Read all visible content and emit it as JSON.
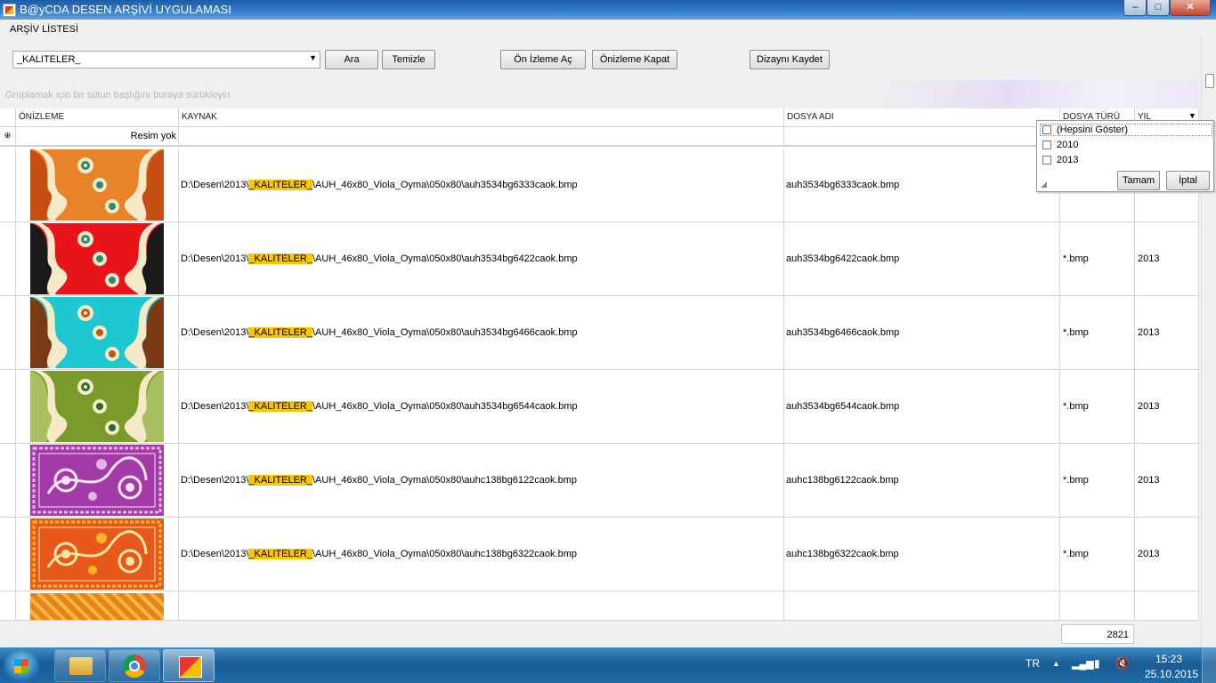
{
  "window": {
    "title": "B@yCDA DESEN ARŞİVİ UYGULAMASI",
    "controls": {
      "minimize": "–",
      "maximize": "□",
      "close": "✕"
    }
  },
  "menu": {
    "arsiv_listesi": "ARŞİV LİSTESİ"
  },
  "toolbar": {
    "combo_value": "_KALITELER_",
    "ara": "Ara",
    "temizle": "Temizle",
    "onizleme_ac": "Ön İzleme Aç",
    "onizleme_kapat": "Önizleme Kapat",
    "dizayn_kaydet": "Dizaynı Kaydet"
  },
  "grid": {
    "group_hint": "Gruplamak için bir sütun başlığını buraya sürükleyin",
    "columns": [
      "ÖNİZLEME",
      "KAYNAK",
      "DOSYA ADI",
      "DOSYA TÜRÜ",
      "YIL"
    ],
    "filter_row": {
      "preview": "Resim yok"
    },
    "rows": [
      {
        "path_pre": "D:\\Desen\\2013\\",
        "path_hl": "_KALITELER_",
        "path_post": "\\AUH_46x80_Viola_Oyma\\050x80\\auh3534bg6333caok.bmp",
        "file": "auh3534bg6333caok.bmp",
        "type": "",
        "year": "",
        "palette": "orange-swirl"
      },
      {
        "path_pre": "D:\\Desen\\2013\\",
        "path_hl": "_KALITELER_",
        "path_post": "\\AUH_46x80_Viola_Oyma\\050x80\\auh3534bg6422caok.bmp",
        "file": "auh3534bg6422caok.bmp",
        "type": "*.bmp",
        "year": "2013",
        "palette": "red-swirl"
      },
      {
        "path_pre": "D:\\Desen\\2013\\",
        "path_hl": "_KALITELER_",
        "path_post": "\\AUH_46x80_Viola_Oyma\\050x80\\auh3534bg6466caok.bmp",
        "file": "auh3534bg6466caok.bmp",
        "type": "*.bmp",
        "year": "2013",
        "palette": "cyan-swirl"
      },
      {
        "path_pre": "D:\\Desen\\2013\\",
        "path_hl": "_KALITELER_",
        "path_post": "\\AUH_46x80_Viola_Oyma\\050x80\\auh3534bg6544caok.bmp",
        "file": "auh3534bg6544caok.bmp",
        "type": "*.bmp",
        "year": "2013",
        "palette": "olive-swirl"
      },
      {
        "path_pre": "D:\\Desen\\2013\\",
        "path_hl": "_KALITELER_",
        "path_post": "\\AUH_46x80_Viola_Oyma\\050x80\\auhc138bg6122caok.bmp",
        "file": "auhc138bg6122caok.bmp",
        "type": "*.bmp",
        "year": "2013",
        "palette": "purple-ornament"
      },
      {
        "path_pre": "D:\\Desen\\2013\\",
        "path_hl": "_KALITELER_",
        "path_post": "\\AUH_46x80_Viola_Oyma\\050x80\\auhc138bg6322caok.bmp",
        "file": "auhc138bg6322caok.bmp",
        "type": "*.bmp",
        "year": "2013",
        "palette": "orange-ornament"
      }
    ],
    "record_count": "2821"
  },
  "filter_popup": {
    "items": [
      "(Hepsini Göster)",
      "2010",
      "2013"
    ],
    "ok": "Tamam",
    "cancel": "İptal"
  },
  "taskbar": {
    "apps": [
      "explorer-icon",
      "chrome-icon",
      "app-icon"
    ],
    "language": "TR",
    "time": "15:23",
    "date": "25.10.2015"
  },
  "colors": {
    "titlebar": "#2f79c7",
    "highlight": "#f9c600",
    "taskbar": "#1a5b95"
  }
}
